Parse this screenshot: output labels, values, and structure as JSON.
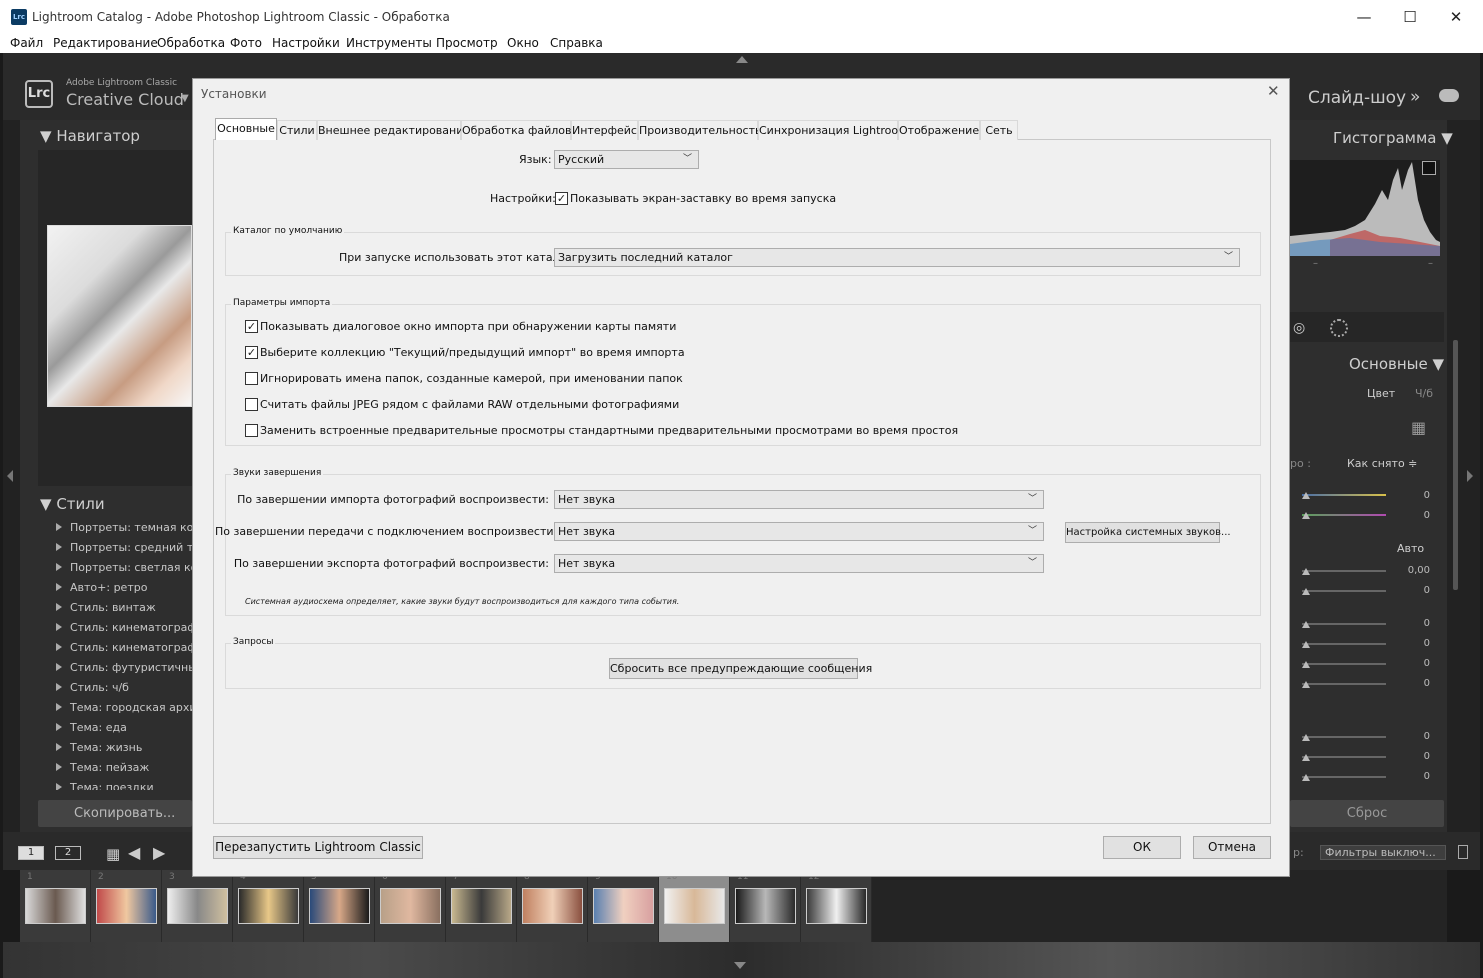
{
  "window": {
    "title": "Lightroom Catalog - Adobe Photoshop Lightroom Classic - Обработка",
    "app_icon": "Lrc",
    "minimize": "—",
    "maximize": "☐",
    "close": "✕"
  },
  "menu": [
    "Файл",
    "Редактирование",
    "Обработка",
    "Фото",
    "Настройки",
    "Инструменты",
    "Просмотр",
    "Окно",
    "Справка"
  ],
  "lightroom": {
    "logo": "Lrc",
    "brand_small": "Adobe Lightroom Classic",
    "brand_big": "Creative Cloud",
    "module": "Слайд-шоу",
    "module_more": "»",
    "left_panels": {
      "navigator": "Навигатор",
      "styles": "Стили",
      "style_items": [
        "Портреты: темная кожа",
        "Портреты: средний тон",
        "Портреты: светлая кожа",
        "Авто+: ретро",
        "Стиль: винтаж",
        "Стиль: кинематографический",
        "Стиль: кинематографический II",
        "Стиль: футуристичный",
        "Стиль: ч/б",
        "Тема: городская архитектура",
        "Тема: еда",
        "Тема: жизнь",
        "Тема: пейзаж",
        "Тема: поездки"
      ],
      "copy_button": "Скопировать..."
    },
    "right_panels": {
      "histogram": "Гистограмма",
      "hist_dash": "–",
      "basic": "Основные",
      "color": "Цвет",
      "bw": "Ч/б",
      "profile_prefix": "ро :",
      "as_shot": "Как снято ≑",
      "auto": "Авто",
      "exposure_value": "0,00",
      "zero": "0",
      "reset_button": "Сброс"
    },
    "filmstrip": {
      "screen1": "1",
      "screen2": "2",
      "filter_label": "р:",
      "filter": "Фильтры выключ...",
      "selected_index": 9,
      "thumb_numbers": [
        "1",
        "2",
        "3",
        "4",
        "5",
        "6",
        "7",
        "8",
        "9",
        "10",
        "11",
        "12"
      ]
    }
  },
  "dialog": {
    "title": "Установки",
    "close": "✕",
    "tabs": [
      "Основные",
      "Стили",
      "Внешнее редактирование",
      "Обработка файлов",
      "Интерфейс",
      "Производительность",
      "Синхронизация Lightroom",
      "Отображение",
      "Сеть"
    ],
    "active_tab": 0,
    "language_label": "Язык:",
    "language_value": "Русский",
    "settings_label": "Настройки:",
    "splash_label": "Показывать экран-заставку во время запуска",
    "splash_checked": true,
    "catalog_group": "Каталог по умолчанию",
    "catalog_label": "При запуске использовать этот каталог:",
    "catalog_value": "Загрузить последний каталог",
    "import_group": "Параметры импорта",
    "import_options": [
      {
        "label": "Показывать диалоговое окно импорта при обнаружении карты памяти",
        "checked": true
      },
      {
        "label": "Выберите коллекцию \"Текущий/предыдущий импорт\" во время импорта",
        "checked": true
      },
      {
        "label": "Игнорировать имена папок, созданные камерой, при именовании папок",
        "checked": false
      },
      {
        "label": "Считать файлы JPEG рядом с файлами RAW отдельными фотографиями",
        "checked": false
      },
      {
        "label": "Заменить встроенные предварительные просмотры стандартными предварительными просмотрами во время простоя",
        "checked": false
      }
    ],
    "sounds_group": "Звуки завершения",
    "sound_import_label": "По завершении импорта фотографий воспроизвести:",
    "sound_tether_label": "По завершении передачи с подключением воспроизвести:",
    "sound_export_label": "По завершении экспорта фотографий воспроизвести:",
    "sound_value": "Нет звука",
    "system_sounds_button": "Настройка системных звуков...",
    "sound_note": "Системная аудиосхема определяет, какие звуки будут воспроизводиться для каждого типа события.",
    "prompts_group": "Запросы",
    "reset_warnings_button": "Сбросить все предупреждающие сообщения",
    "restart_button": "Перезапустить Lightroom Classic",
    "ok_button": "ОК",
    "cancel_button": "Отмена"
  }
}
